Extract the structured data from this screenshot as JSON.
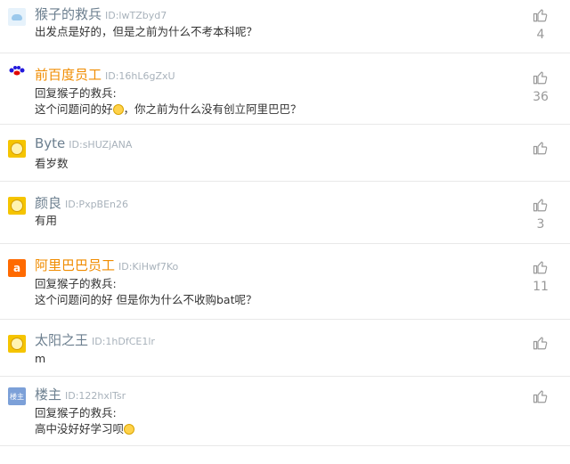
{
  "comments": [
    {
      "name": "猴子的救兵",
      "id": "ID:lwTZbyd7",
      "avatar": "cloud-avatar",
      "official": false,
      "reply_prefix": "",
      "text": "出发点是好的，但是之前为什么不考本科呢？",
      "emoji": false,
      "likes": "4"
    },
    {
      "name": "前百度员工",
      "id": "ID:16hL6gZxU",
      "avatar": "baidu-logo-avatar",
      "official": true,
      "reply_prefix": "回复猴子的救兵:",
      "text": "这个问题问的好",
      "text_after_emoji": "，你之前为什么没有创立阿里巴巴？",
      "emoji": true,
      "likes": "36"
    },
    {
      "name": "Byte",
      "id": "ID:sHUZjANA",
      "avatar": "default-avatar",
      "official": false,
      "reply_prefix": "",
      "text": "看岁数",
      "emoji": false,
      "likes": ""
    },
    {
      "name": "颜良",
      "id": "ID:PxpBEn26",
      "avatar": "default-avatar",
      "official": false,
      "reply_prefix": "",
      "text": "有用",
      "emoji": false,
      "likes": "3"
    },
    {
      "name": "阿里巴巴员工",
      "id": "ID:KiHwf7Ko",
      "avatar": "alibaba-logo-avatar",
      "official": true,
      "reply_prefix": "回复猴子的救兵:",
      "text": "这个问题问的好 但是你为什么不收购bat呢？",
      "emoji": false,
      "likes": "11"
    },
    {
      "name": "太阳之王",
      "id": "ID:1hDfCE1lr",
      "avatar": "default-avatar",
      "official": false,
      "reply_prefix": "",
      "text": "m",
      "emoji": false,
      "likes": ""
    },
    {
      "name": "楼主",
      "id": "ID:122hxlTsr",
      "avatar": "louzhu-avatar",
      "official": false,
      "reply_prefix": "回复猴子的救兵:",
      "text": "高中没好好学习呗",
      "emoji": true,
      "likes": ""
    }
  ],
  "avatar_labels": {
    "louzhu": "楼主",
    "alibaba": "a"
  },
  "colors": {
    "official_name": "#f08c00",
    "normal_name": "#6c7f8f",
    "id_text": "#a8b2bb",
    "divider": "#e8e8e8"
  },
  "icons": {
    "like": "thumbs-up-icon"
  }
}
